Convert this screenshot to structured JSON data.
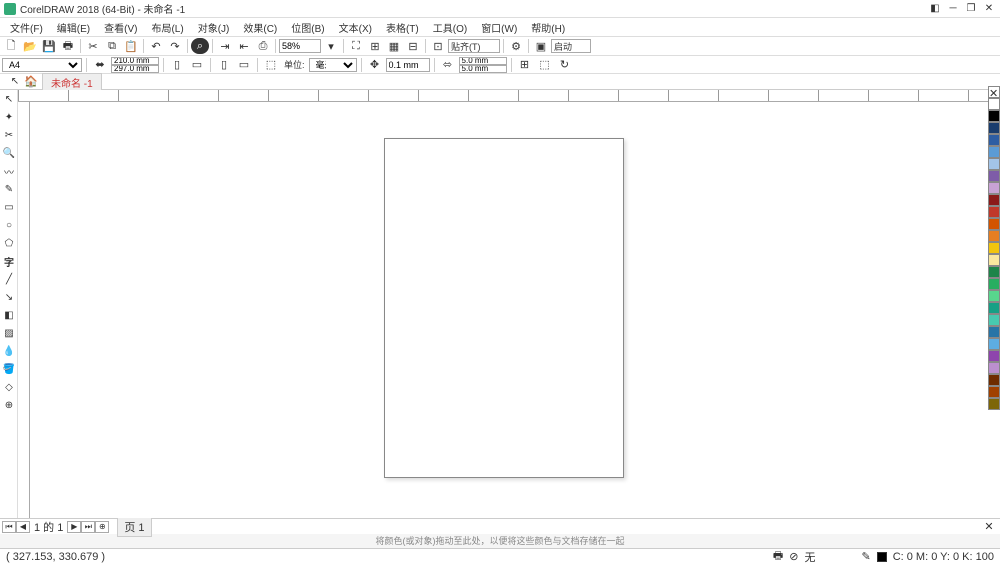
{
  "title": "CorelDRAW 2018 (64-Bit) - 未命名 -1",
  "menus": [
    "文件(F)",
    "编辑(E)",
    "查看(V)",
    "布局(L)",
    "对象(J)",
    "效果(C)",
    "位图(B)",
    "文本(X)",
    "表格(T)",
    "工具(O)",
    "窗口(W)",
    "帮助(H)"
  ],
  "toolbar": {
    "zoom": "58%",
    "snap": "贴齐(T)",
    "launch": "启动"
  },
  "propbar": {
    "paper": "A4",
    "width": "210.0 mm",
    "height": "297.0 mm",
    "unitlabel": "单位:",
    "unit": "毫米",
    "nudge": "0.1 mm",
    "dupx": "5.0 mm",
    "dupy": "5.0 mm"
  },
  "doc": {
    "tab": "未命名 -1"
  },
  "pager": {
    "text": "1 的 1",
    "page": "页 1"
  },
  "hint": "将颜色(或对象)拖动至此处，以便将这些颜色与文档存储在一起",
  "status": {
    "coords": "( 327.153, 330.679 )",
    "fill": "无",
    "cmyk": "C: 0 M: 0 Y: 0 K: 100"
  },
  "colors": [
    "#ffffff",
    "#000000",
    "#1a3d6d",
    "#2e5ea3",
    "#5b9bd5",
    "#a3c4e8",
    "#7e5ca8",
    "#c8a2d4",
    "#8b1a1a",
    "#c0392b",
    "#d35400",
    "#e67e22",
    "#f1c40f",
    "#f9e79f",
    "#1e8449",
    "#27ae60",
    "#58d68d",
    "#16a085",
    "#48c9b0",
    "#2874a6",
    "#5dade2",
    "#8e44ad",
    "#bb8fce",
    "#6e2c00",
    "#a04000",
    "#7d6608"
  ]
}
